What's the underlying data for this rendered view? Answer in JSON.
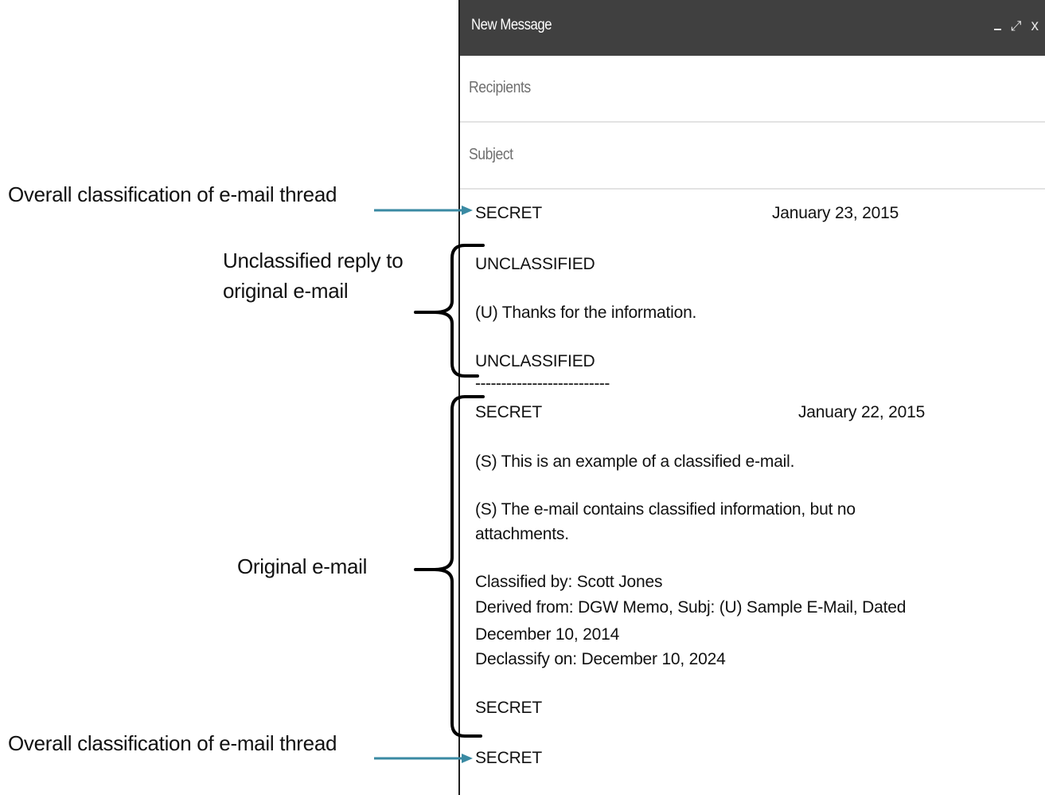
{
  "compose": {
    "title": "New Message",
    "controls": {
      "minimize": "_",
      "expand": "⤢",
      "close": "x"
    },
    "recipients_placeholder": "Recipients",
    "subject_placeholder": "Subject"
  },
  "message": {
    "thread_header_marking": "SECRET",
    "thread_header_date": "January 23, 2015",
    "reply": {
      "top_marking": "UNCLASSIFIED",
      "body": "(U) Thanks for the information.",
      "bottom_marking": "UNCLASSIFIED"
    },
    "separator": "--------------------------",
    "original": {
      "top_marking": "SECRET",
      "date": "January 22, 2015",
      "para1": "(S) This is an example of a classified e-mail.",
      "para2_line1": "(S) The e-mail contains classified information, but no",
      "para2_line2": "attachments.",
      "classified_by": "Classified by:  Scott Jones",
      "derived_from_line1": "Derived from:  DGW Memo, Subj:  (U) Sample E-Mail, Dated",
      "derived_from_line2": "December 10, 2014",
      "declassify_on": "Declassify on:  December 10, 2024",
      "bottom_marking": "SECRET"
    },
    "thread_footer_marking": "SECRET"
  },
  "annotations": {
    "overall_top": "Overall classification of e-mail thread",
    "reply_line1": "Unclassified reply to",
    "reply_line2": "original e-mail",
    "original": "Original e-mail",
    "overall_bottom": "Overall classification of e-mail thread"
  },
  "colors": {
    "arrow": "#3a8aa3",
    "header_bg": "#404040",
    "brace": "#000000"
  }
}
